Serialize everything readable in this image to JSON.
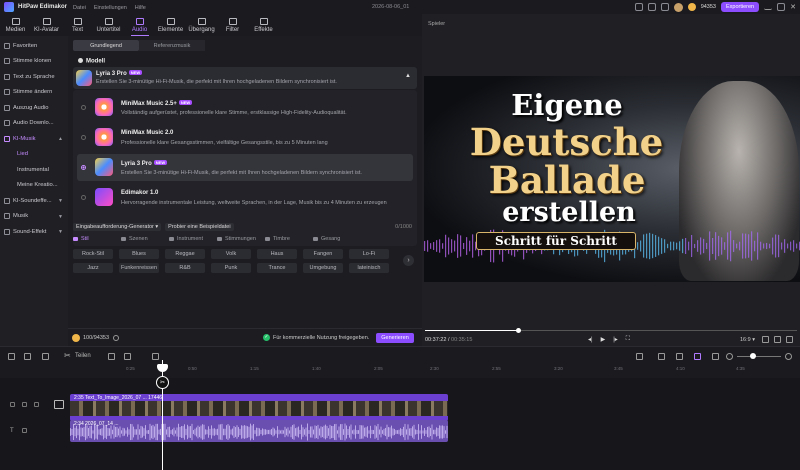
{
  "app": {
    "name": "HitPaw Edimakor",
    "project": "2026-08-06_01"
  },
  "menu": [
    "Datei",
    "Einstellungen",
    "Hilfe"
  ],
  "topright": {
    "points": "94353",
    "export_label": "Exportieren"
  },
  "toolbar": [
    "Medien",
    "KI-Avatar",
    "Text",
    "Untertitel",
    "Audio",
    "Elemente",
    "Übergang",
    "Filter",
    "Effekte"
  ],
  "sidebar": [
    {
      "label": "Favoriten",
      "sub": false
    },
    {
      "label": "Stimme klonen",
      "sub": false
    },
    {
      "label": "Text zu Sprache",
      "sub": false
    },
    {
      "label": "Stimme ändern",
      "sub": false
    },
    {
      "label": "Auszug Audio",
      "sub": false
    },
    {
      "label": "Audio Downlo...",
      "sub": false
    },
    {
      "label": "KI-Musik",
      "sub": false
    },
    {
      "label": "Lied",
      "sub": true
    },
    {
      "label": "Instrumental",
      "sub": true
    },
    {
      "label": "Meine Kreatio...",
      "sub": true
    },
    {
      "label": "KI-Soundeffe...",
      "sub": false
    },
    {
      "label": "Musik",
      "sub": false
    },
    {
      "label": "Sound-Effekt",
      "sub": false
    }
  ],
  "panel": {
    "tabs": [
      "Grundlegend",
      "Referenzmusik"
    ],
    "section_title": "Modell",
    "selected_model": {
      "name": "Lyria 3 Pro",
      "badge": "NEW",
      "desc": "Erstellen Sie 3-minütige Hi-Fi-Musik, die perfekt mit Ihren hochgeladenen Bildern synchronisiert ist."
    },
    "models": [
      {
        "name": "MiniMax Music 2.5+",
        "badge": "NEW",
        "desc": "Vollständig aufgerüstet, professionelle klare Stimme, erstklassige High-Fidelity-Audioqualität."
      },
      {
        "name": "MiniMax Music 2.0",
        "badge": "",
        "desc": "Professionelle klare Gesangsstimmen, vielfältige Gesangsstile, bis zu 5 Minuten lang"
      },
      {
        "name": "Lyria 3 Pro",
        "badge": "NEW",
        "desc": "Erstellen Sie 3-minütige Hi-Fi-Musik, die perfekt mit Ihren hochgeladenen Bildern synchronisiert ist."
      },
      {
        "name": "Edimakor 1.0",
        "badge": "",
        "desc": "Hervorragende instrumentale Leistung, weltweite Sprachen, in der Lage, Musik bis zu 4 Minuten zu erzeugen"
      }
    ],
    "prompt_gen": "Eingabeaufforderung-Generator",
    "sample": "Probier eine Beispieldatei",
    "counter": "0/1000",
    "style_tabs": [
      "Stil",
      "Szenen",
      "Instrument",
      "Stimmungen",
      "Timbre",
      "Gesang"
    ],
    "styles": [
      "Rock-Stil",
      "Blues",
      "Reggae",
      "Volk",
      "Haus",
      "Fangen",
      "Lo-Fi",
      "Jazz",
      "Funkenreissen",
      "R&B",
      "Punk",
      "Trance",
      "Umgebung",
      "lateinisch"
    ],
    "credits": "100/94353",
    "commercial": "Für kommerzielle Nutzung freigegeben.",
    "generate": "Generieren"
  },
  "player": {
    "label": "Spieler",
    "video_lines": [
      "Eigene",
      "Deutsche",
      "Ballade",
      "erstellen"
    ],
    "banner": "Schritt für Schritt",
    "current": "00:37:22",
    "total": "00:35:15",
    "progress": 0.25,
    "ratio": "16:9"
  },
  "timeline": {
    "split_label": "Teilen",
    "ticks": [
      "0:25",
      "0:50",
      "1:15",
      "1:40",
      "2:05",
      "2:30",
      "2:55",
      "3:20",
      "3:45",
      "4:10",
      "4:35"
    ],
    "video_clip": "2:35 Text_To_Image_2026_07 ... 17446",
    "audio_clip": "2:34 2026_07_14 ..."
  }
}
